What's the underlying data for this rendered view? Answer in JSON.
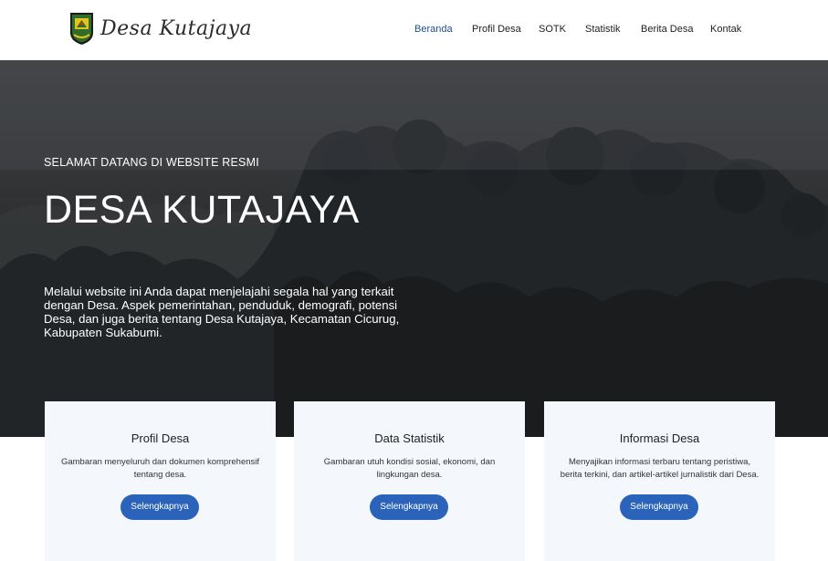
{
  "header": {
    "logo_text": "Desa Kutajaya",
    "logo_icon": "village-emblem-icon",
    "nav": [
      {
        "label": "Beranda",
        "active": true
      },
      {
        "label": "Profil Desa",
        "active": false
      },
      {
        "label": "SOTK",
        "active": false
      },
      {
        "label": "Statistik",
        "active": false
      },
      {
        "label": "Berita Desa",
        "active": false
      },
      {
        "label": "Kontak",
        "active": false
      }
    ],
    "active_color": "#1f4f8f"
  },
  "hero": {
    "kicker": "SELAMAT DATANG DI WEBSITE RESMI",
    "title": "DESA KUTAJAYA",
    "description": "Melalui website ini Anda dapat menjelajahi segala hal yang terkait dengan Desa. Aspek pemerintahan, penduduk, demografi, potensi Desa, dan juga berita tentang Desa Kutajaya, Kecamatan Cicurug, Kabupaten Sukabumi."
  },
  "cards": [
    {
      "title": "Profil Desa",
      "description": "Gambaran menyeluruh dan dokumen komprehensif tentang desa.",
      "button_label": "Selengkapnya"
    },
    {
      "title": "Data Statistik",
      "description": "Gambaran utuh kondisi sosial, ekonomi, dan lingkungan desa.",
      "button_label": "Selengkapnya"
    },
    {
      "title": "Informasi Desa",
      "description": "Menyajikan informasi terbaru tentang peristiwa, berita terkini, dan artikel-artikel jurnalistik dari Desa.",
      "button_label": "Selengkapnya"
    }
  ],
  "colors": {
    "button": "#2a63b9",
    "card_bg": "#f4f7fb"
  }
}
